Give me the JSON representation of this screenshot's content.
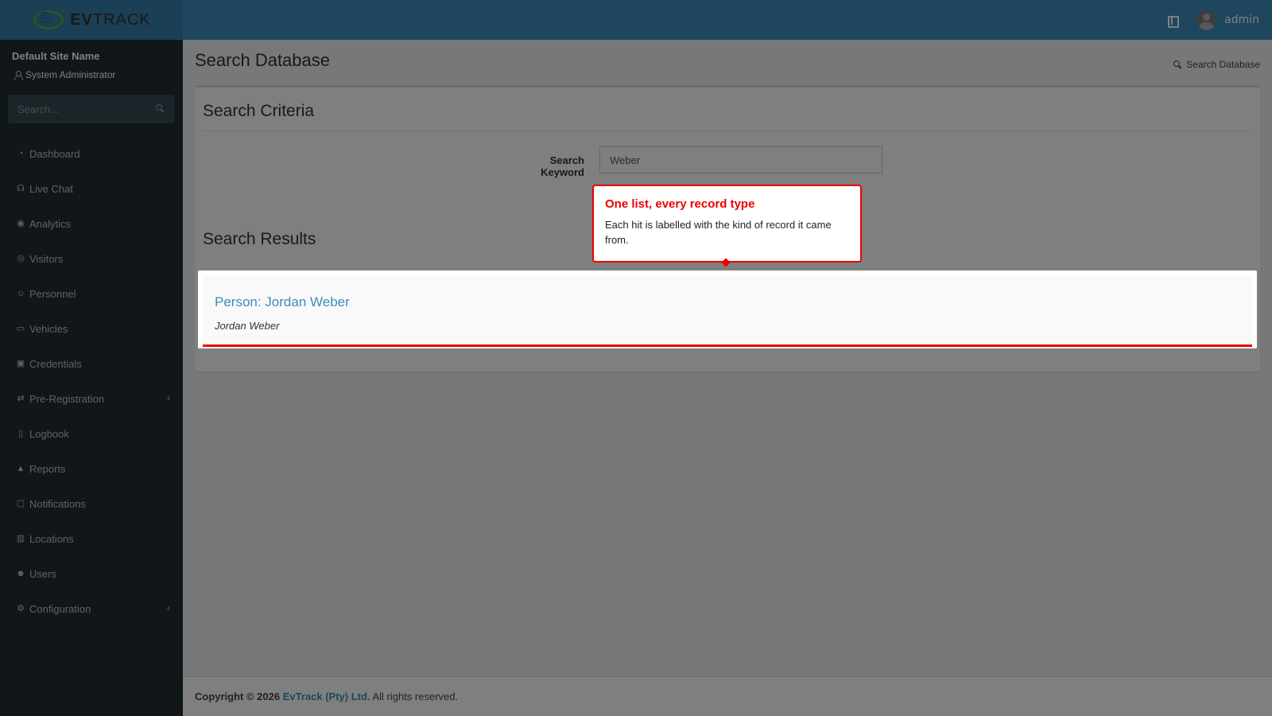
{
  "brand": {
    "mark": "E",
    "name_bold": "EV",
    "name_rest": "TRACK"
  },
  "header": {
    "user_name": "admin",
    "book_icon": "book-icon",
    "avatar_icon": "avatar"
  },
  "sidebar": {
    "site_name": "Default Site Name",
    "user_role": "System Administrator",
    "search_placeholder": "Search...",
    "items": [
      {
        "label": "Dashboard",
        "icon": "dashboard-icon",
        "glyph": "◔"
      },
      {
        "label": "Live Chat",
        "icon": "headset-icon",
        "glyph": "☊"
      },
      {
        "label": "Analytics",
        "icon": "target-icon",
        "glyph": "◉"
      },
      {
        "label": "Visitors",
        "icon": "eye-icon",
        "glyph": "◎"
      },
      {
        "label": "Personnel",
        "icon": "personnel-icon",
        "glyph": "☺"
      },
      {
        "label": "Vehicles",
        "icon": "car-icon",
        "glyph": "▭"
      },
      {
        "label": "Credentials",
        "icon": "badge-icon",
        "glyph": "▣"
      },
      {
        "label": "Pre-Registration",
        "icon": "arrows-icon",
        "glyph": "⇄",
        "chevron": "‹"
      },
      {
        "label": "Logbook",
        "icon": "book-icon",
        "glyph": "▯"
      },
      {
        "label": "Reports",
        "icon": "chart-icon",
        "glyph": "▲"
      },
      {
        "label": "Notifications",
        "icon": "chat-icon",
        "glyph": "▢"
      },
      {
        "label": "Locations",
        "icon": "map-icon",
        "glyph": "▥"
      },
      {
        "label": "Users",
        "icon": "user-gear-icon",
        "glyph": "☻"
      },
      {
        "label": "Configuration",
        "icon": "gear-icon",
        "glyph": "⚙",
        "chevron": "‹"
      }
    ]
  },
  "page": {
    "title": "Search Database",
    "breadcrumb": "Search Database",
    "criteria_title": "Search Criteria",
    "keyword_label": "Search Keyword",
    "keyword_value": "Weber",
    "results_title": "Search Results",
    "results": [
      {
        "title": "Person: Jordan Weber",
        "subtitle": "Jordan Weber"
      }
    ]
  },
  "tooltip": {
    "title": "One list, every record type",
    "body": "Each hit is labelled with the kind of record it came from."
  },
  "footer": {
    "copyright": "Copyright © 2026",
    "company": "EvTrack (Pty) Ltd.",
    "rights": "All rights reserved."
  },
  "colors": {
    "header": "#3c8dbc",
    "sidebar": "#222d32",
    "accent_red": "#ee0000",
    "link": "#3c8dbc"
  }
}
